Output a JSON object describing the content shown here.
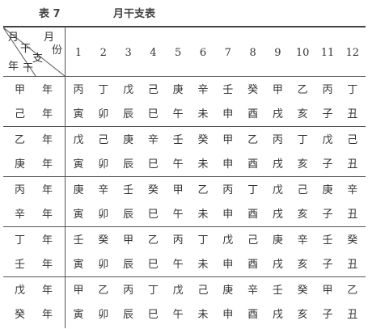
{
  "caption": {
    "number": "表 7",
    "title": "月干支表"
  },
  "corner": {
    "yue_top": "月",
    "gan_mid": "干",
    "zhi": "支",
    "yue_right": "月",
    "fen": "份",
    "nian": "年",
    "gan_bottom": "干"
  },
  "months": [
    "1",
    "2",
    "3",
    "4",
    "5",
    "6",
    "7",
    "8",
    "9",
    "10",
    "11",
    "12"
  ],
  "groups": [
    {
      "years": [
        {
          "stem": "甲",
          "suffix": "年"
        },
        {
          "stem": "己",
          "suffix": "年"
        }
      ],
      "stems": [
        "丙",
        "丁",
        "戊",
        "己",
        "庚",
        "辛",
        "壬",
        "癸",
        "甲",
        "乙",
        "丙",
        "丁"
      ],
      "branches": [
        "寅",
        "卯",
        "辰",
        "巳",
        "午",
        "未",
        "申",
        "酉",
        "戌",
        "亥",
        "子",
        "丑"
      ]
    },
    {
      "years": [
        {
          "stem": "乙",
          "suffix": "年"
        },
        {
          "stem": "庚",
          "suffix": "年"
        }
      ],
      "stems": [
        "戊",
        "己",
        "庚",
        "辛",
        "壬",
        "癸",
        "甲",
        "乙",
        "丙",
        "丁",
        "戊",
        "己"
      ],
      "branches": [
        "寅",
        "卯",
        "辰",
        "巳",
        "午",
        "未",
        "申",
        "酉",
        "戌",
        "亥",
        "子",
        "丑"
      ]
    },
    {
      "years": [
        {
          "stem": "丙",
          "suffix": "年"
        },
        {
          "stem": "辛",
          "suffix": "年"
        }
      ],
      "stems": [
        "庚",
        "辛",
        "壬",
        "癸",
        "甲",
        "乙",
        "丙",
        "丁",
        "戊",
        "己",
        "庚",
        "辛"
      ],
      "branches": [
        "寅",
        "卯",
        "辰",
        "巳",
        "午",
        "未",
        "申",
        "酉",
        "戌",
        "亥",
        "子",
        "丑"
      ]
    },
    {
      "years": [
        {
          "stem": "丁",
          "suffix": "年"
        },
        {
          "stem": "壬",
          "suffix": "年"
        }
      ],
      "stems": [
        "壬",
        "癸",
        "甲",
        "乙",
        "丙",
        "丁",
        "戊",
        "己",
        "庚",
        "辛",
        "壬",
        "癸"
      ],
      "branches": [
        "寅",
        "卯",
        "辰",
        "巳",
        "午",
        "未",
        "申",
        "酉",
        "戌",
        "亥",
        "子",
        "丑"
      ]
    },
    {
      "years": [
        {
          "stem": "戊",
          "suffix": "年"
        },
        {
          "stem": "癸",
          "suffix": "年"
        }
      ],
      "stems": [
        "甲",
        "乙",
        "丙",
        "丁",
        "戊",
        "己",
        "庚",
        "辛",
        "壬",
        "癸",
        "甲",
        "乙"
      ],
      "branches": [
        "寅",
        "卯",
        "辰",
        "巳",
        "午",
        "未",
        "申",
        "酉",
        "戌",
        "亥",
        "子",
        "丑"
      ]
    }
  ]
}
